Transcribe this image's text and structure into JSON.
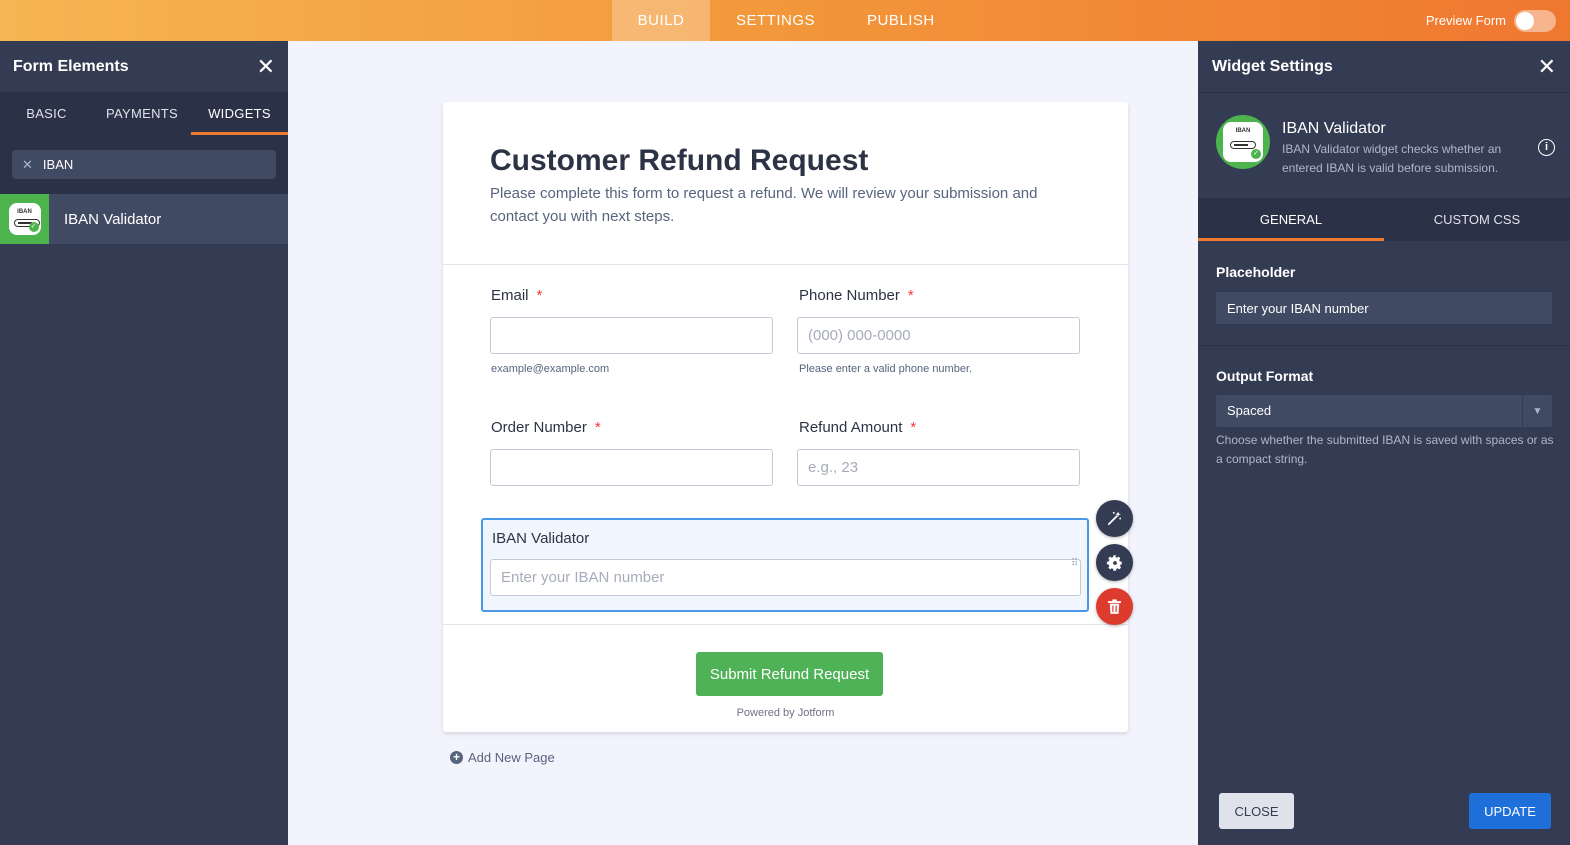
{
  "topbar": {
    "tabs": [
      {
        "label": "BUILD"
      },
      {
        "label": "SETTINGS"
      },
      {
        "label": "PUBLISH"
      }
    ],
    "preview_label": "Preview Form"
  },
  "left_panel": {
    "title": "Form Elements",
    "tabs": [
      {
        "label": "BASIC"
      },
      {
        "label": "PAYMENTS"
      },
      {
        "label": "WIDGETS"
      }
    ],
    "search_value": "IBAN",
    "results": [
      {
        "label": "IBAN Validator",
        "icon": "iban-validator-icon"
      }
    ]
  },
  "form": {
    "title": "Customer Refund Request",
    "description": "Please complete this form to request a refund. We will review your submission and contact you with next steps.",
    "required_mark": "*",
    "fields": {
      "email": {
        "label": "Email",
        "hint": "example@example.com",
        "placeholder": ""
      },
      "phone": {
        "label": "Phone Number",
        "placeholder": "(000) 000-0000",
        "hint": "Please enter a valid phone number."
      },
      "order": {
        "label": "Order Number",
        "placeholder": ""
      },
      "refund": {
        "label": "Refund Amount",
        "placeholder": "e.g., 23"
      },
      "iban": {
        "label": "IBAN Validator",
        "placeholder": "Enter your IBAN number"
      }
    },
    "submit_label": "Submit Refund Request",
    "powered_by": "Powered by Jotform"
  },
  "add_page_label": "Add New Page",
  "widget_badge_text": "IBAN",
  "right_panel": {
    "title": "Widget Settings",
    "widget_name": "IBAN Validator",
    "widget_description": "IBAN Validator widget checks whether an entered IBAN is valid before submission.",
    "tabs": [
      {
        "label": "GENERAL"
      },
      {
        "label": "CUSTOM CSS"
      }
    ],
    "placeholder_section": {
      "label": "Placeholder",
      "value": "Enter your IBAN number"
    },
    "output_section": {
      "label": "Output Format",
      "selected": "Spaced",
      "help": "Choose whether the submitted IBAN is saved with spaces or as a compact string."
    },
    "close_label": "CLOSE",
    "update_label": "UPDATE"
  },
  "colors": {
    "accent_orange": "#f07a2f",
    "panel_dark": "#343c53",
    "submit_green": "#4fb257",
    "update_blue": "#1e6fd9",
    "selection_blue": "#4a98e8",
    "delete_red": "#dd3b2e"
  }
}
